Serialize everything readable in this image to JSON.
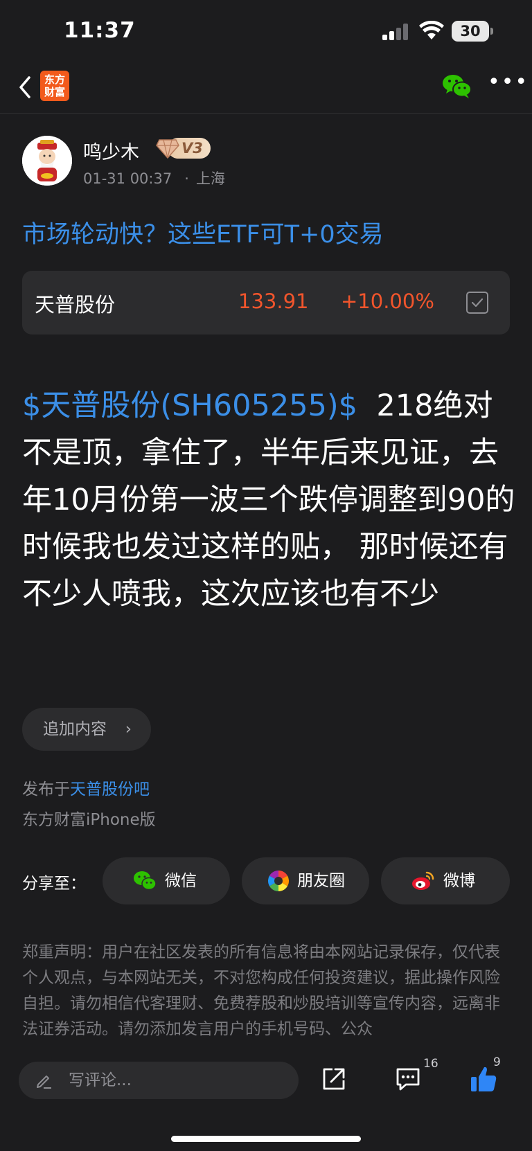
{
  "status_bar": {
    "time": "11:37",
    "battery": "30"
  },
  "nav": {
    "app_logo_line1": "东方",
    "app_logo_line2": "财富"
  },
  "author": {
    "name": "鸣少木",
    "level": "V3",
    "datetime": "01-31 00:37",
    "location": "上海"
  },
  "post": {
    "title": "市场轮动快？这些ETF可T+0交易",
    "stock_tag": "$天普股份(SH605255)$",
    "body": "218绝对不是顶，拿住了，半年后来见证，去年10月份第一波三个跌停调整到90的时候我也发过这样的贴， 那时候还有不少人喷我，这次应该也有不少"
  },
  "stock_card": {
    "name": "天普股份",
    "price": "133.91",
    "change": "+10.00%"
  },
  "add_content": {
    "label": "追加内容",
    "chevron": "›"
  },
  "published": {
    "prefix": "发布于",
    "bar": "天普股份吧",
    "client": "东方财富iPhone版"
  },
  "share": {
    "label": "分享至：",
    "wechat": "微信",
    "moments": "朋友圈",
    "weibo": "微博"
  },
  "disclaimer": "郑重声明：用户在社区发表的所有信息将由本网站记录保存，仅代表个人观点，与本网站无关，不对您构成任何投资建议，据此操作风险自担。请勿相信代客理财、免费荐股和炒股培训等宣传内容，远离非法证券活动。请勿添加发言用户的手机号码、公众",
  "bottom_bar": {
    "comment_placeholder": "写评论...",
    "comment_count": "16",
    "like_count": "9"
  },
  "colors": {
    "accent_blue": "#3b8fe8",
    "up_red": "#f2552c",
    "background": "#1c1c1e",
    "card": "#2c2c2e",
    "brand_orange": "#f25a1c",
    "wechat_green": "#2dc100"
  },
  "icons": [
    "back-icon",
    "wechat-icon",
    "more-icon",
    "signal-icon",
    "wifi-icon",
    "battery-icon",
    "checkbox-icon",
    "moments-icon",
    "weibo-icon",
    "pen-icon",
    "share-out-icon",
    "comment-icon",
    "like-icon"
  ]
}
